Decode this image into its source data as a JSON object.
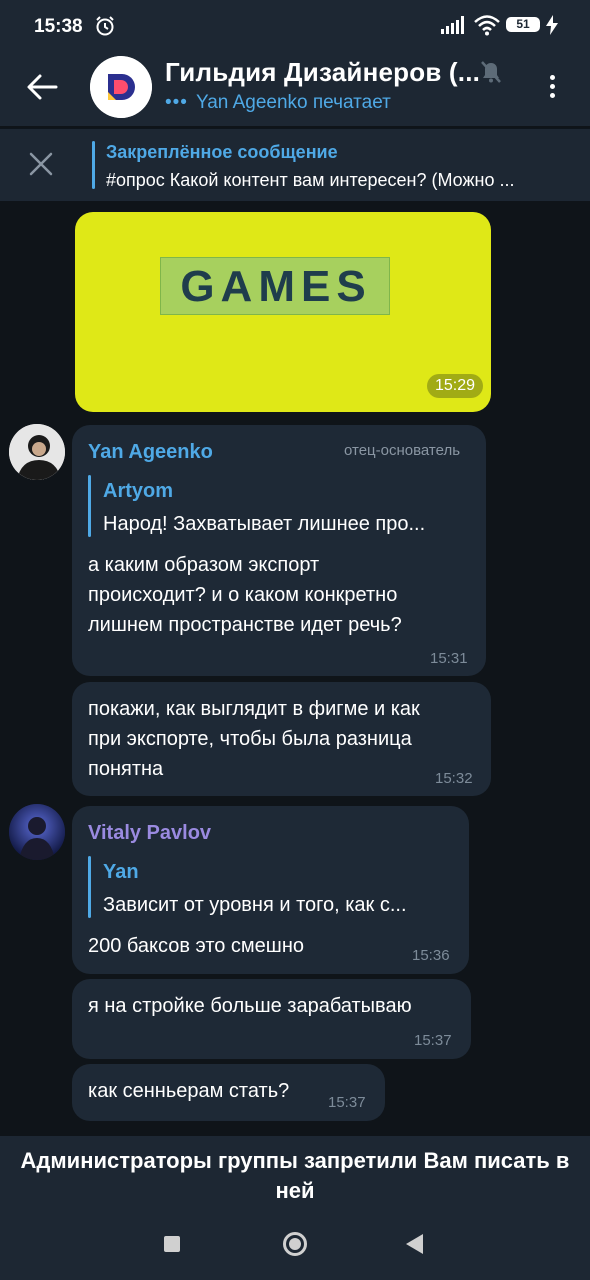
{
  "status_bar": {
    "time": "15:38",
    "battery": "51",
    "icons": [
      "alarm-icon",
      "signal-icon",
      "wifi-icon",
      "battery-icon",
      "bolt-icon"
    ]
  },
  "header": {
    "title": "Гильдия Дизайнеров (...",
    "typing": "Yan Ageenko печатает",
    "icons": [
      "back-arrow-icon",
      "mute-icon",
      "more-vert-icon"
    ]
  },
  "pinned": {
    "title": "Закреплённое сообщение",
    "text": "#опрос Какой контент вам интересен? (Можно ..."
  },
  "image_message": {
    "image_text": "GAMES",
    "time": "15:29",
    "background_color": "#dfe817"
  },
  "messages": [
    {
      "sender": "Yan Ageenko",
      "role": "отец-основатель",
      "sender_color": "#4fa9e6",
      "reply": {
        "name": "Artyom",
        "text": "Народ! Захватывает лишнее про..."
      },
      "lines": [
        "а каким образом экспорт",
        "происходит? и о каком конкретно",
        "лишнем пространстве идет речь?"
      ],
      "time": "15:31"
    },
    {
      "lines": [
        "покажи, как выглядит в фигме и как",
        "при экспорте, чтобы была разница",
        "понятна"
      ],
      "time": "15:32"
    },
    {
      "sender": "Vitaly Pavlov",
      "sender_color": "#9a8ae0",
      "reply": {
        "name": "Yan",
        "text": "Зависит от уровня и того, как с..."
      },
      "lines": [
        "200 баксов это смешно"
      ],
      "time": "15:36"
    },
    {
      "lines": [
        "я на стройке больше зарабатываю"
      ],
      "time": "15:37"
    },
    {
      "lines": [
        "как сенньерам стать?"
      ],
      "time": "15:37"
    }
  ],
  "restriction_notice": "Администраторы группы запретили Вам писать в ней",
  "colors": {
    "background": "#0f1419",
    "panel": "#1d2733",
    "bubble": "#1e2936",
    "accent": "#4fa9e6"
  }
}
